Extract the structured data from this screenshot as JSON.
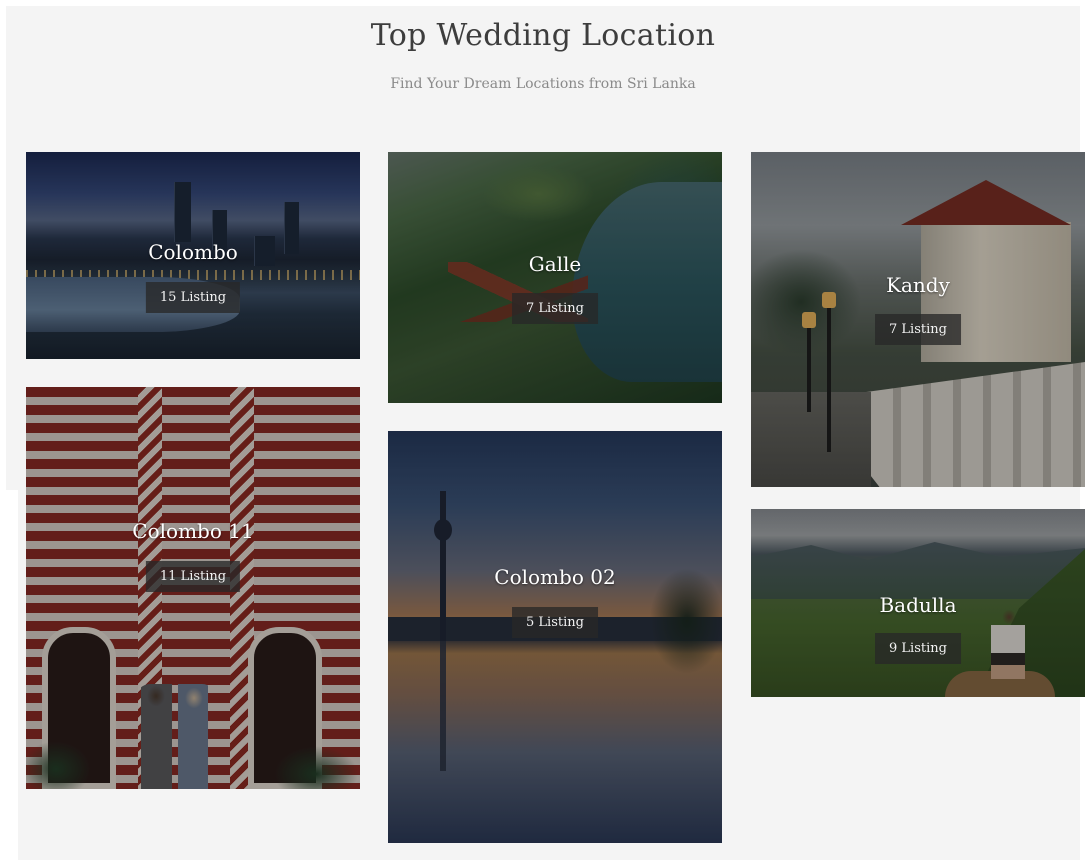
{
  "header": {
    "title": "Top Wedding Location",
    "subtitle": "Find Your Dream Locations from Sri Lanka"
  },
  "locations": [
    {
      "name": "Colombo",
      "listing": "15 Listing"
    },
    {
      "name": "Galle",
      "listing": "7 Listing"
    },
    {
      "name": "Kandy",
      "listing": "7 Listing"
    },
    {
      "name": "Colombo 11",
      "listing": "11 Listing"
    },
    {
      "name": "Colombo 02",
      "listing": "5 Listing"
    },
    {
      "name": "Badulla",
      "listing": "9 Listing"
    }
  ],
  "colors": {
    "background": "#f4f4f4",
    "title": "#3d3d3d",
    "subtitle": "#8a8a8a",
    "badge": "#282828"
  }
}
